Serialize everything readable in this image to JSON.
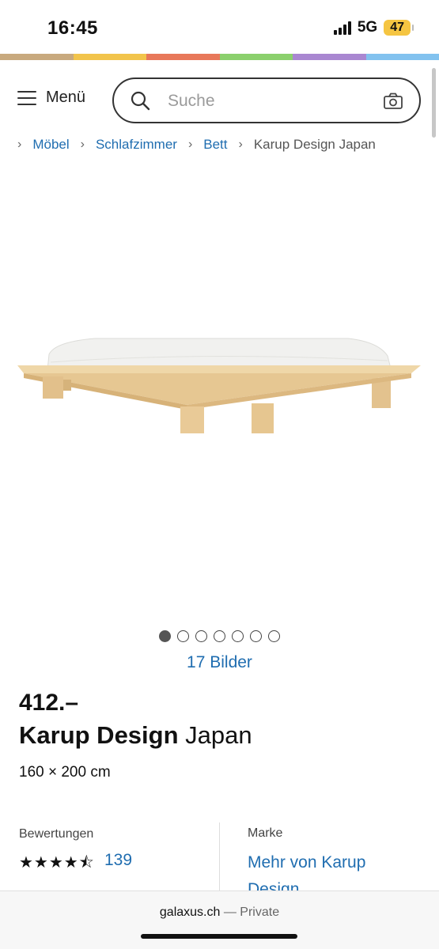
{
  "status_bar": {
    "time": "16:45",
    "network": "5G",
    "battery": "47"
  },
  "brand_colors": [
    "#c8a97e",
    "#f2c44b",
    "#e8785a",
    "#8bd06d",
    "#a987d1",
    "#82c2ef"
  ],
  "header": {
    "menu_label": "Menü",
    "search_placeholder": "Suche"
  },
  "breadcrumb": [
    "Möbel",
    "Schlafzimmer",
    "Bett",
    "Karup Design Japan"
  ],
  "gallery": {
    "dot_count": 7,
    "active_dot": 1,
    "images_link": "17 Bilder"
  },
  "product": {
    "price": "412.–",
    "brand": "Karup Design",
    "model": "Japan",
    "dimensions": "160 × 200 cm"
  },
  "ratings": {
    "label": "Bewertungen",
    "stars": 4.5,
    "stars_text": "★★★★⯪",
    "count": "139"
  },
  "brand_info": {
    "label": "Marke",
    "link": "Mehr von Karup Design"
  },
  "browser": {
    "domain": "galaxus.ch",
    "mode": "— Private"
  }
}
